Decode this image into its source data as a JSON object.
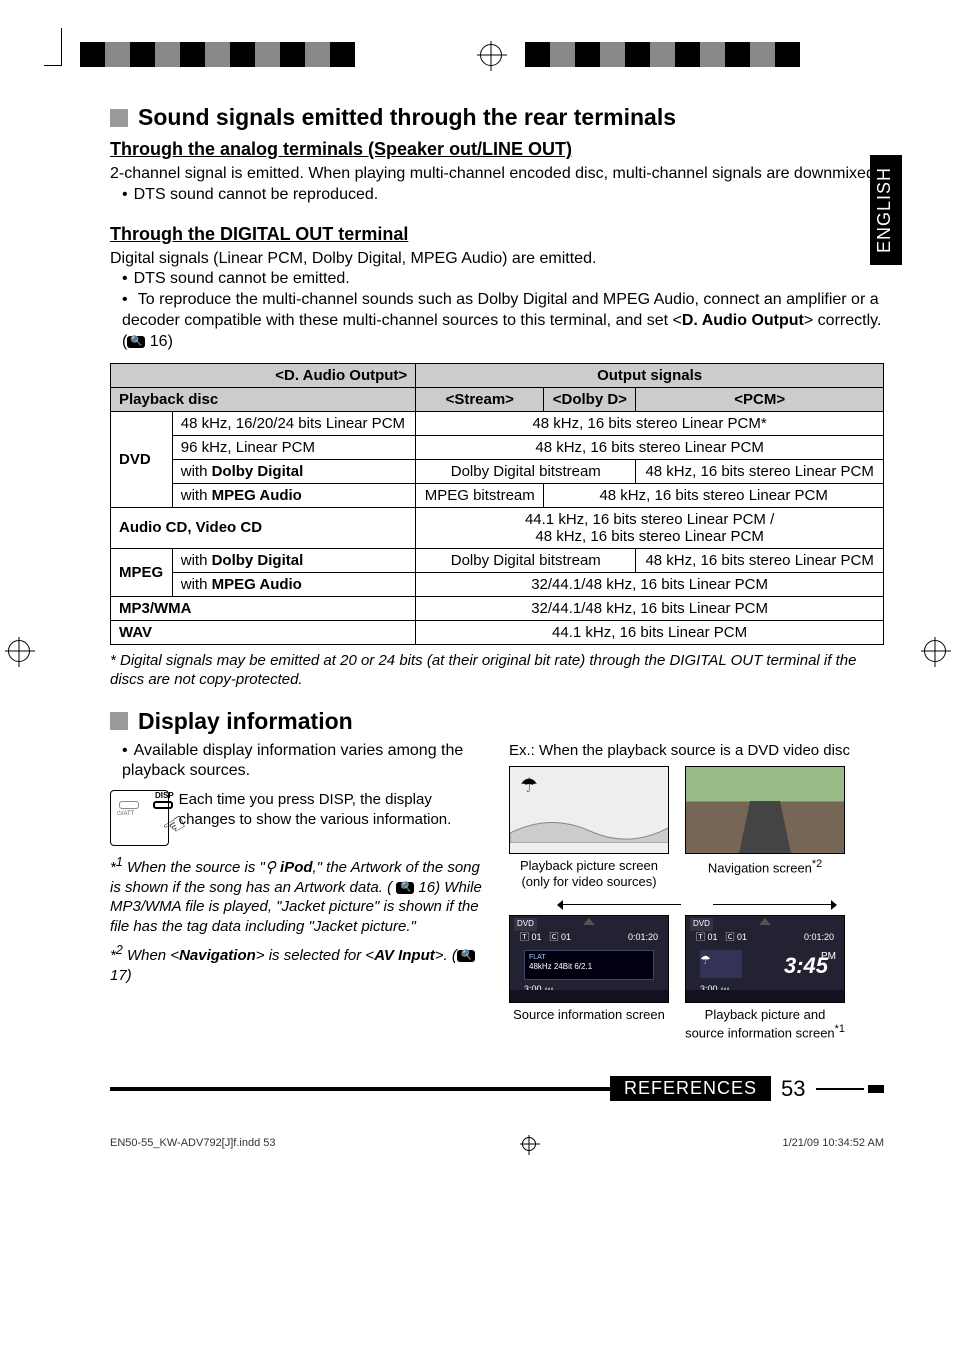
{
  "lang_tab": "ENGLISH",
  "section1": {
    "title": "Sound signals emitted through the rear terminals",
    "sub1": {
      "heading": "Through the analog terminals (Speaker out/LINE OUT)",
      "para": "2-channel signal is emitted. When playing multi-channel encoded disc, multi-channel signals are downmixed.",
      "bullet1": "DTS sound cannot be reproduced."
    },
    "sub2": {
      "heading": "Through the DIGITAL OUT terminal",
      "para": "Digital signals (Linear PCM, Dolby Digital, MPEG Audio) are emitted.",
      "bullet1": "DTS sound cannot be emitted.",
      "bullet2_a": "To reproduce the multi-channel sounds such as Dolby Digital and MPEG Audio, connect an amplifier or a decoder compatible with these multi-channel sources to this terminal, and set <",
      "bullet2_b": "D. Audio Output",
      "bullet2_c": "> correctly. (",
      "bullet2_d": " 16)"
    }
  },
  "table": {
    "hdr_daudio": "<D. Audio Output>",
    "hdr_output": "Output signals",
    "hdr_playback": "Playback disc",
    "hdr_stream": "<Stream>",
    "hdr_dolbyd": "<Dolby D>",
    "hdr_pcm": "<PCM>",
    "dvd": "DVD",
    "r1a": "48 kHz, 16/20/24 bits Linear PCM",
    "r1b": "48 kHz, 16 bits stereo Linear PCM*",
    "r2a": "96 kHz, Linear PCM",
    "r2b": "48 kHz, 16 bits stereo Linear PCM",
    "r3a_pre": "with ",
    "r3a_bold": "Dolby Digital",
    "r3b": "Dolby Digital bitstream",
    "r3c": "48 kHz, 16 bits stereo Linear PCM",
    "r4a_pre": "with ",
    "r4a_bold": "MPEG Audio",
    "r4b": "MPEG bitstream",
    "r4c": "48 kHz, 16 bits stereo Linear PCM",
    "r5a": "Audio CD, Video CD",
    "r5b_l1": "44.1 kHz, 16 bits stereo Linear PCM /",
    "r5b_l2": "48 kHz, 16 bits stereo Linear PCM",
    "mpeg": "MPEG",
    "r6b": "Dolby Digital bitstream",
    "r6c": "48 kHz, 16 bits stereo Linear PCM",
    "r7b": "32/44.1/48 kHz, 16 bits Linear PCM",
    "r8a": "MP3/WMA",
    "r8b": "32/44.1/48 kHz, 16 bits Linear PCM",
    "r9a": "WAV",
    "r9b": "44.1 kHz, 16 bits Linear PCM"
  },
  "table_footnote": "*  Digital signals may be emitted at 20 or 24 bits (at their original bit rate) through the DIGITAL OUT terminal if the discs are not copy-protected.",
  "section2": {
    "title": "Display information",
    "bullet": "Available display information varies among the playback sources.",
    "remote_text": "Each time you press DISP, the display changes to show the various information.",
    "remote_lbl_att": "/ATT",
    "remote_lbl_disp": "DISP",
    "fn1_a": "When the source is \"",
    "fn1_b": "iPod",
    "fn1_c": ",\" the Artwork of the song is shown if the song has an Artwork data. ( ",
    "fn1_d": " 16) While MP3/WMA file is played, \"Jacket picture\" is shown if the file has the tag data including \"Jacket picture.\"",
    "fn2_a": "When <",
    "fn2_b": "Navigation",
    "fn2_c": "> is selected for <",
    "fn2_d": "AV Input",
    "fn2_e": ">. (",
    "fn2_f": " 17)",
    "right_intro": "Ex.:  When the playback source is a DVD video disc",
    "cap1": "Playback picture screen (only for video sources)",
    "cap2_a": "Navigation screen",
    "cap2_b": "*2",
    "cap3": "Source information screen",
    "cap4_a": "Playback picture and source information screen",
    "cap4_b": "*1",
    "src_dvd": "DVD",
    "src_t": "01",
    "src_c": "01",
    "src_time": "0:01:20",
    "src_flat": "FLAT",
    "src_info": "48kHz  24Bit  6/2.1",
    "src_clock_small": "3:00",
    "src_big_clock": "3:45",
    "src_pm": "PM"
  },
  "footer": {
    "ref": "REFERENCES",
    "page": "53"
  },
  "printline": {
    "left": "EN50-55_KW-ADV792[J]f.indd   53",
    "right": "1/21/09   10:34:52 AM"
  }
}
